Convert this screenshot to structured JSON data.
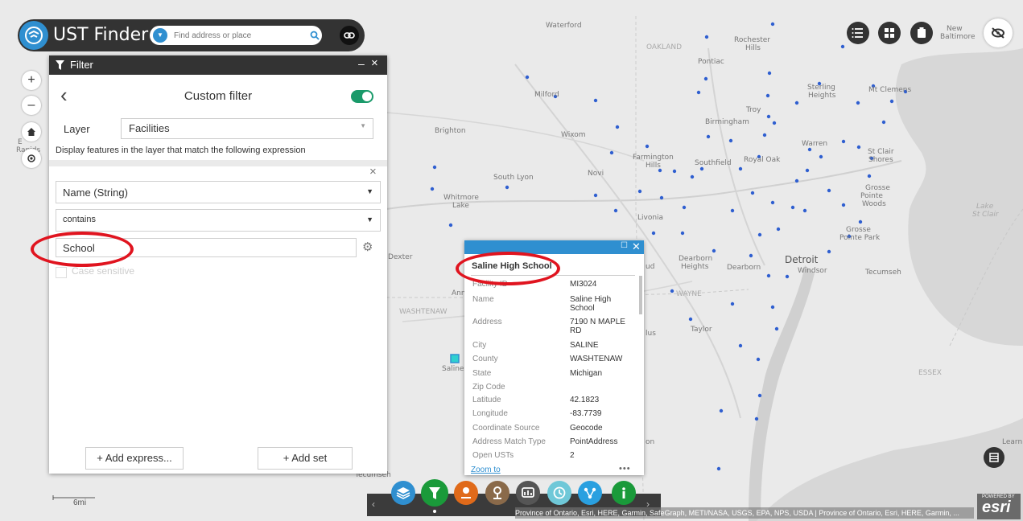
{
  "header": {
    "app_title": "UST Finder",
    "search_placeholder": "Find address or place"
  },
  "filter_panel": {
    "title": "Filter",
    "minimize": "–",
    "close": "×",
    "back": "‹",
    "heading": "Custom filter",
    "toggle_on": true,
    "layer_label": "Layer",
    "layer_value": "Facilities",
    "description": "Display features in the layer that match the following expression",
    "remove": "×",
    "field_value": "Name (String)",
    "operator_value": "contains",
    "value_text": "School",
    "case_label": "Case sensitive",
    "add_expression": "+ Add express...",
    "add_set": "+ Add set"
  },
  "popup": {
    "title": "Saline High School",
    "rows": [
      {
        "label": "Facility ID",
        "value": "MI3024"
      },
      {
        "label": "Name",
        "value": "Saline High School"
      },
      {
        "label": "Address",
        "value": "7190 N MAPLE RD"
      },
      {
        "label": "City",
        "value": "SALINE"
      },
      {
        "label": "County",
        "value": "WASHTENAW"
      },
      {
        "label": "State",
        "value": "Michigan"
      },
      {
        "label": "Zip Code",
        "value": ""
      },
      {
        "label": "Latitude",
        "value": "42.1823"
      },
      {
        "label": "Longitude",
        "value": "-83.7739"
      },
      {
        "label": "Coordinate Source",
        "value": "Geocode"
      },
      {
        "label": "Address Match Type",
        "value": "PointAddress"
      },
      {
        "label": "Open USTs",
        "value": "2"
      }
    ],
    "zoom_to": "Zoom to",
    "more": "•••"
  },
  "map_labels": {
    "waterford": "Waterford",
    "oakland": "OAKLAND",
    "pontiac": "Pontiac",
    "rochester": "Rochester",
    "hills": "Hills",
    "new_baltimore": "New",
    "baltimore": "Baltimore",
    "milford": "Milford",
    "sterling": "Sterling",
    "heights": "Heights",
    "mt_clemens": "Mt Clemens",
    "troy": "Troy",
    "birmingham": "Birmingham",
    "brighton": "Brighton",
    "wixom": "Wixom",
    "warren": "Warren",
    "farmington": "Farmington",
    "farmington_hills": "Hills",
    "southfield": "Southfield",
    "royal_oak": "Royal Oak",
    "st_clair": "St Clair",
    "shores": "Shores",
    "novi": "Novi",
    "south_lyon": "South Lyon",
    "grosse_pointe": "Grosse",
    "pointe": "Pointe",
    "woods": "Woods",
    "whitmore": "Whitmore",
    "lake": "Lake",
    "livonia": "Livonia",
    "lake_st_clair_1": "Lake",
    "lake_st_clair_2": "St Clair",
    "grosse_pointe_park_1": "Grosse",
    "grosse_pointe_park_2": "Pointe Park",
    "dexter": "Dexter",
    "dearborn_heights_1": "Dearborn",
    "dearborn_heights_2": "Heights",
    "dearborn": "Dearborn",
    "detroit": "Detroit",
    "windsor": "Windsor",
    "tecumseh": "Tecumseh",
    "ann": "Ann",
    "wayne": "WAYNE",
    "washtenaw": "WASHTENAW",
    "taylor": "Taylor",
    "saline": "Saline",
    "essex": "ESSEX",
    "ud": "ud",
    "lus": "lus",
    "on": "on",
    "rapids_1": "E",
    "rapids_2": "Rapids",
    "tecumseh_bottom": "Tecumseh",
    "learn": "Learn"
  },
  "scalebar": "6mi",
  "attribution": "Province of Ontario, Esri, HERE, Garmin, SafeGraph, METI/NASA, USGS, EPA, NPS, USDA | Province of Ontario, Esri, HERE, Garmin, ...",
  "esri": {
    "powered_by": "POWERED BY",
    "name": "esri"
  },
  "widgets": [
    "layers",
    "filter",
    "analysis",
    "query",
    "report",
    "time",
    "share",
    "about"
  ],
  "colors": {
    "accent_blue": "#2f8fd0",
    "point_blue": "#2f5fd0",
    "toggle_green": "#1a9a6a",
    "highlight_red": "#e0141f",
    "header_dark": "#333333"
  }
}
